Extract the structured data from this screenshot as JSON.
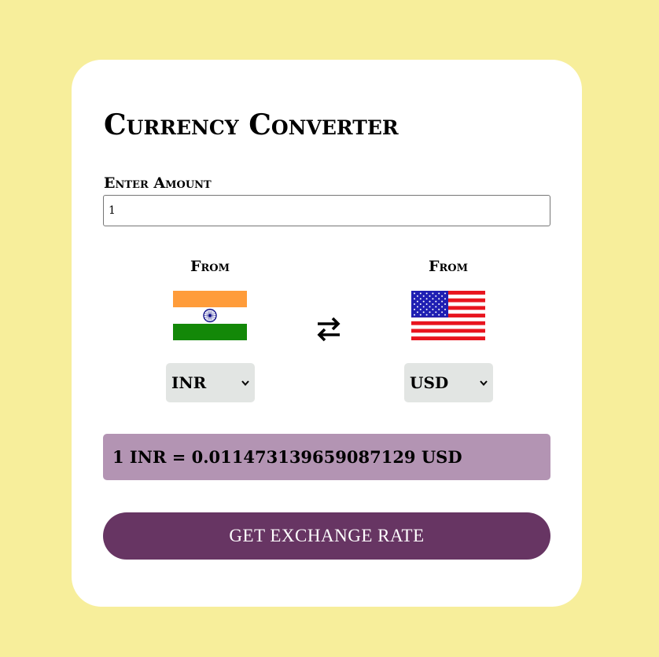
{
  "app": {
    "title": "Currency Converter"
  },
  "amount": {
    "label": "Enter Amount",
    "value": "1"
  },
  "from_currency": {
    "label": "From",
    "flag": "india-flag-icon",
    "selected": "INR"
  },
  "to_currency": {
    "label": "From",
    "flag": "usa-flag-icon",
    "selected": "USD"
  },
  "swap": {
    "icon": "swap-arrows-icon"
  },
  "result": {
    "text": "1 INR = 0.011473139659087129 USD"
  },
  "button": {
    "label": "GET EXCHANGE RATE"
  },
  "colors": {
    "background": "#f7ee9b",
    "card": "#ffffff",
    "result_bg": "#b394b3",
    "button_bg": "#673563",
    "select_bg": "#e2e5e3"
  }
}
